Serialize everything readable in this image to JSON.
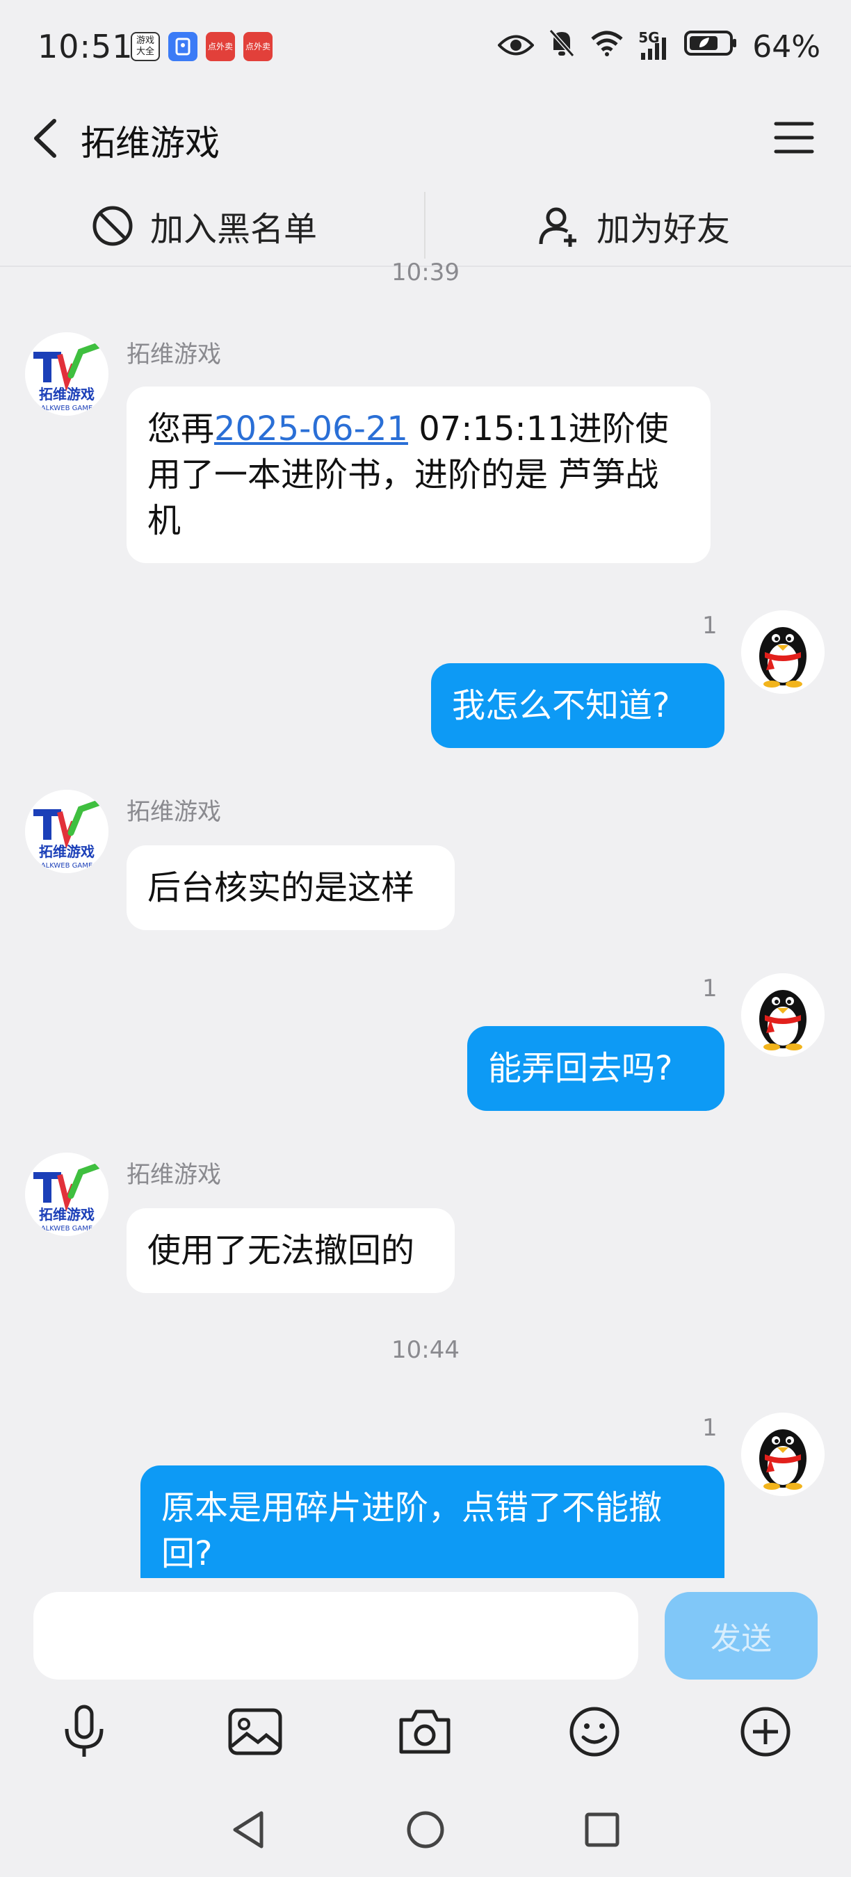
{
  "status_bar": {
    "time": "10:51",
    "app_icons": [
      {
        "name": "game-center",
        "label": "游戏大全"
      },
      {
        "name": "blue-app",
        "label": ""
      },
      {
        "name": "red-app-1",
        "label": "点外卖"
      },
      {
        "name": "red-app-2",
        "label": "点外卖"
      }
    ],
    "network": "5G",
    "battery": "64%"
  },
  "header": {
    "title": "拓维游戏"
  },
  "actions": {
    "block": "加入黑名单",
    "add_friend": "加为好友"
  },
  "chat": {
    "timestamp1": "10:39",
    "m1": {
      "sender": "拓维游戏",
      "prefix": "您再",
      "link": "2025-06-21",
      "suffix": " 07:15:11进阶使用了一本进阶书，进阶的是 芦笋战机"
    },
    "m2": {
      "read": "1",
      "text": "我怎么不知道?"
    },
    "m3": {
      "sender": "拓维游戏",
      "text": "后台核实的是这样"
    },
    "m4": {
      "read": "1",
      "text": "能弄回去吗?"
    },
    "m5": {
      "sender": "拓维游戏",
      "text": "使用了无法撤回的"
    },
    "timestamp2": "10:44",
    "m6": {
      "read": "1",
      "text": "原本是用碎片进阶，点错了不能撤回?"
    }
  },
  "avatar_text": {
    "brand": "拓维游戏",
    "sub": "ALKWEB GAME"
  },
  "input": {
    "placeholder": "",
    "send": "发送"
  },
  "colors": {
    "my_bubble": "#0d9af5",
    "send_disabled": "#80c7f8",
    "link": "#2a6fd6"
  },
  "toolbar_icons": [
    "microphone-icon",
    "image-icon",
    "camera-icon",
    "emoji-icon",
    "plus-icon"
  ],
  "nav_icons": [
    "back-icon",
    "home-icon",
    "recents-icon"
  ]
}
